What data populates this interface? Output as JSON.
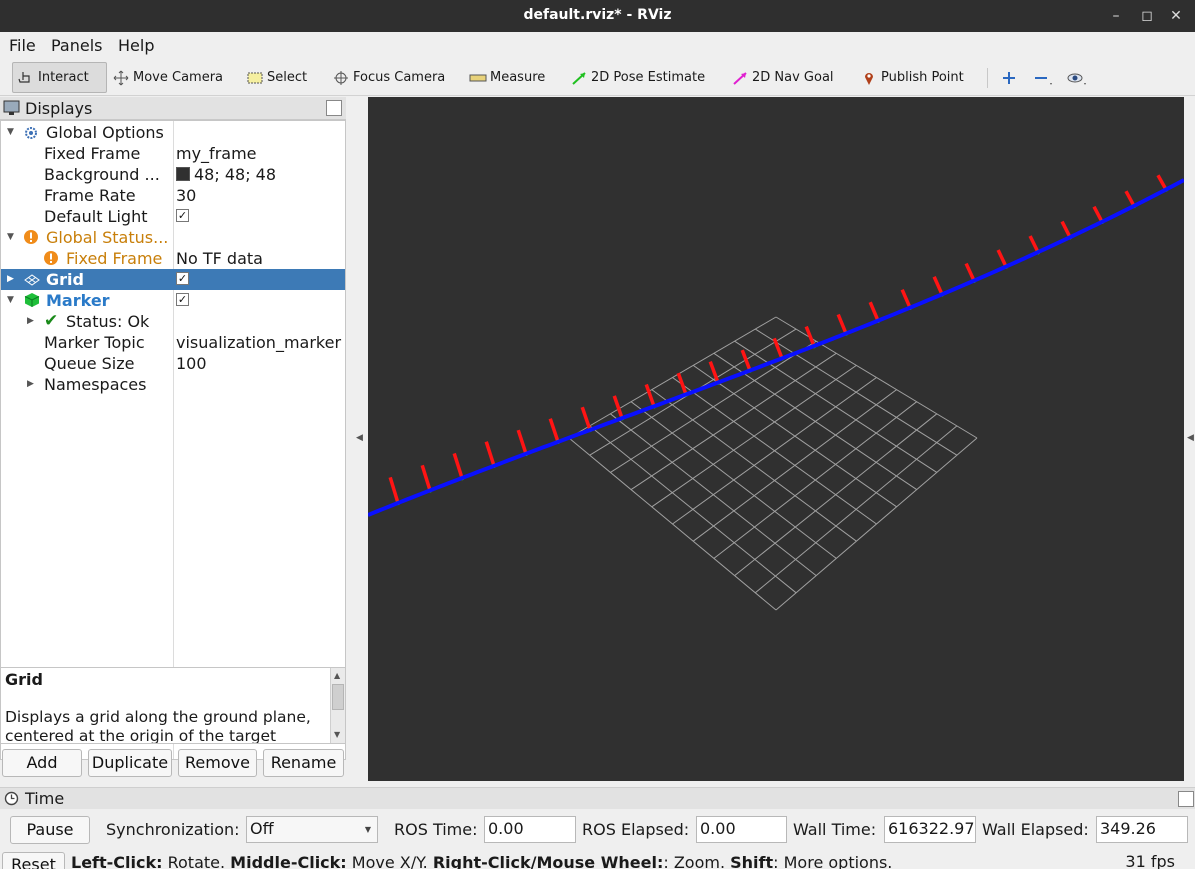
{
  "window": {
    "title": "default.rviz* - RViz",
    "minimize_glyph": "–",
    "maximize_glyph": "◻",
    "close_glyph": "✕"
  },
  "menu": [
    {
      "label": "File",
      "icon": ""
    },
    {
      "label": "Panels",
      "icon": ""
    },
    {
      "label": "Help",
      "icon": ""
    }
  ],
  "toolbar": {
    "interact": "Interact",
    "move_camera": "Move Camera",
    "select": "Select",
    "focus_camera": "Focus Camera",
    "measure": "Measure",
    "pose_estimate": "2D Pose Estimate",
    "nav_goal": "2D Nav Goal",
    "publish_point": "Publish Point",
    "active_tool": "Interact"
  },
  "displays_panel": {
    "title": "Displays",
    "rows": {
      "global_options": {
        "name": "Global Options"
      },
      "fixed_frame": {
        "name": "Fixed Frame",
        "value": "my_frame"
      },
      "background": {
        "name": "Background ...",
        "value": "48; 48; 48",
        "color": "#303030"
      },
      "frame_rate": {
        "name": "Frame Rate",
        "value": "30"
      },
      "default_light": {
        "name": "Default Light",
        "checked": true
      },
      "global_status": {
        "name": "Global Status...",
        "color": "#c87f0a"
      },
      "status_fixed_frame": {
        "name": "Fixed Frame",
        "value": "No TF data",
        "color": "#c87f0a"
      },
      "grid": {
        "name": "Grid",
        "checked": true,
        "selected": true
      },
      "marker": {
        "name": "Marker",
        "checked": true,
        "color": "#2a7ac8"
      },
      "status_ok": {
        "name": "Status: Ok"
      },
      "marker_topic": {
        "name": "Marker Topic",
        "value": "visualization_marker"
      },
      "queue_size": {
        "name": "Queue Size",
        "value": "100"
      },
      "namespaces": {
        "name": "Namespaces"
      }
    },
    "description": {
      "title": "Grid",
      "text": "Displays a grid along the ground plane, centered at the origin of the target"
    },
    "buttons": {
      "add": "Add",
      "duplicate": "Duplicate",
      "remove": "Remove",
      "rename": "Rename"
    }
  },
  "time_panel": {
    "title": "Time",
    "pause": "Pause",
    "sync_label": "Synchronization:",
    "sync_value": "Off",
    "ros_time_label": "ROS Time:",
    "ros_time": "0.00",
    "ros_elapsed_label": "ROS Elapsed:",
    "ros_elapsed": "0.00",
    "wall_time_label": "Wall Time:",
    "wall_time": "616322.97",
    "wall_elapsed_label": "Wall Elapsed:",
    "wall_elapsed": "349.26"
  },
  "statusbar": {
    "reset": "Reset",
    "lc_key": "Left-Click:",
    "lc_val": " Rotate. ",
    "mc_key": "Middle-Click:",
    "mc_val": " Move X/Y. ",
    "rc_key": "Right-Click/Mouse Wheel:",
    "rc_val": ": Zoom. ",
    "sh_key": "Shift",
    "sh_val": ": More options.",
    "fps": "31 fps"
  },
  "scene": {
    "background": "#303030",
    "grid_color": "#a0a0a0",
    "path_color": "#0a10ff",
    "arrow_color": "#ff1414",
    "tick_color": "#30ff30"
  }
}
